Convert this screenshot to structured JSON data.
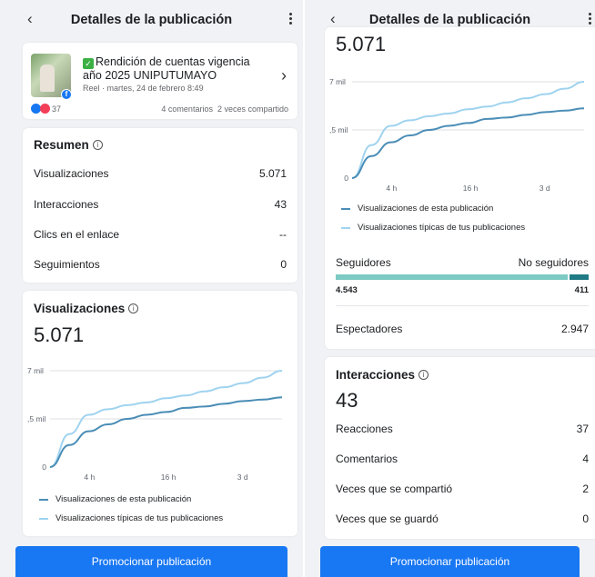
{
  "header": {
    "title": "Detalles de la publicación"
  },
  "post": {
    "title": "Rendición de cuentas vigencia año 2025 UNIPUTUMAYO",
    "meta": "Reel · martes, 24 de febrero 8:49",
    "reaction_count": "37",
    "comments": "4 comentarios",
    "shares": "2 veces compartido"
  },
  "summary": {
    "title": "Resumen",
    "rows": [
      {
        "label": "Visualizaciones",
        "value": "5.071"
      },
      {
        "label": "Interacciones",
        "value": "43"
      },
      {
        "label": "Clics en el enlace",
        "value": "--"
      },
      {
        "label": "Seguimientos",
        "value": "0"
      }
    ]
  },
  "views": {
    "title": "Visualizaciones",
    "total": "5.071"
  },
  "chart_data": {
    "type": "line",
    "x_ticks": [
      "4 h",
      "16 h",
      "3 d"
    ],
    "y_ticks": [
      "0",
      ",5 mil",
      "7 mil"
    ],
    "series": [
      {
        "name": "Visualizaciones de esta publicación",
        "color": "#4a8db6",
        "values": [
          0,
          1.6,
          2.6,
          3.1,
          3.5,
          3.8,
          4.0,
          4.3,
          4.4,
          4.6,
          4.8,
          4.9,
          5.071
        ]
      },
      {
        "name": "Visualizaciones típicas de tus publicaciones",
        "color": "#9fd3ef",
        "values": [
          0,
          2.4,
          3.8,
          4.2,
          4.5,
          4.7,
          5.0,
          5.2,
          5.5,
          5.8,
          6.1,
          6.5,
          7.0
        ]
      }
    ]
  },
  "followers": {
    "label_followers": "Seguidores",
    "label_non": "No seguidores",
    "followers": "4.543",
    "non_followers": "411",
    "followers_frac": 0.917,
    "followers_color": "#7ccac3",
    "non_color": "#1f7a85"
  },
  "viewers": {
    "label": "Espectadores",
    "value": "2.947"
  },
  "interactions": {
    "title": "Interacciones",
    "total": "43",
    "rows": [
      {
        "label": "Reacciones",
        "value": "37"
      },
      {
        "label": "Comentarios",
        "value": "4"
      },
      {
        "label": "Veces que se compartió",
        "value": "2"
      },
      {
        "label": "Veces que se guardó",
        "value": "0"
      }
    ]
  },
  "cta": {
    "label": "Promocionar publicación"
  },
  "icons": {
    "back": "chevron-left-icon",
    "more": "more-vertical-icon",
    "info": "info-icon"
  }
}
